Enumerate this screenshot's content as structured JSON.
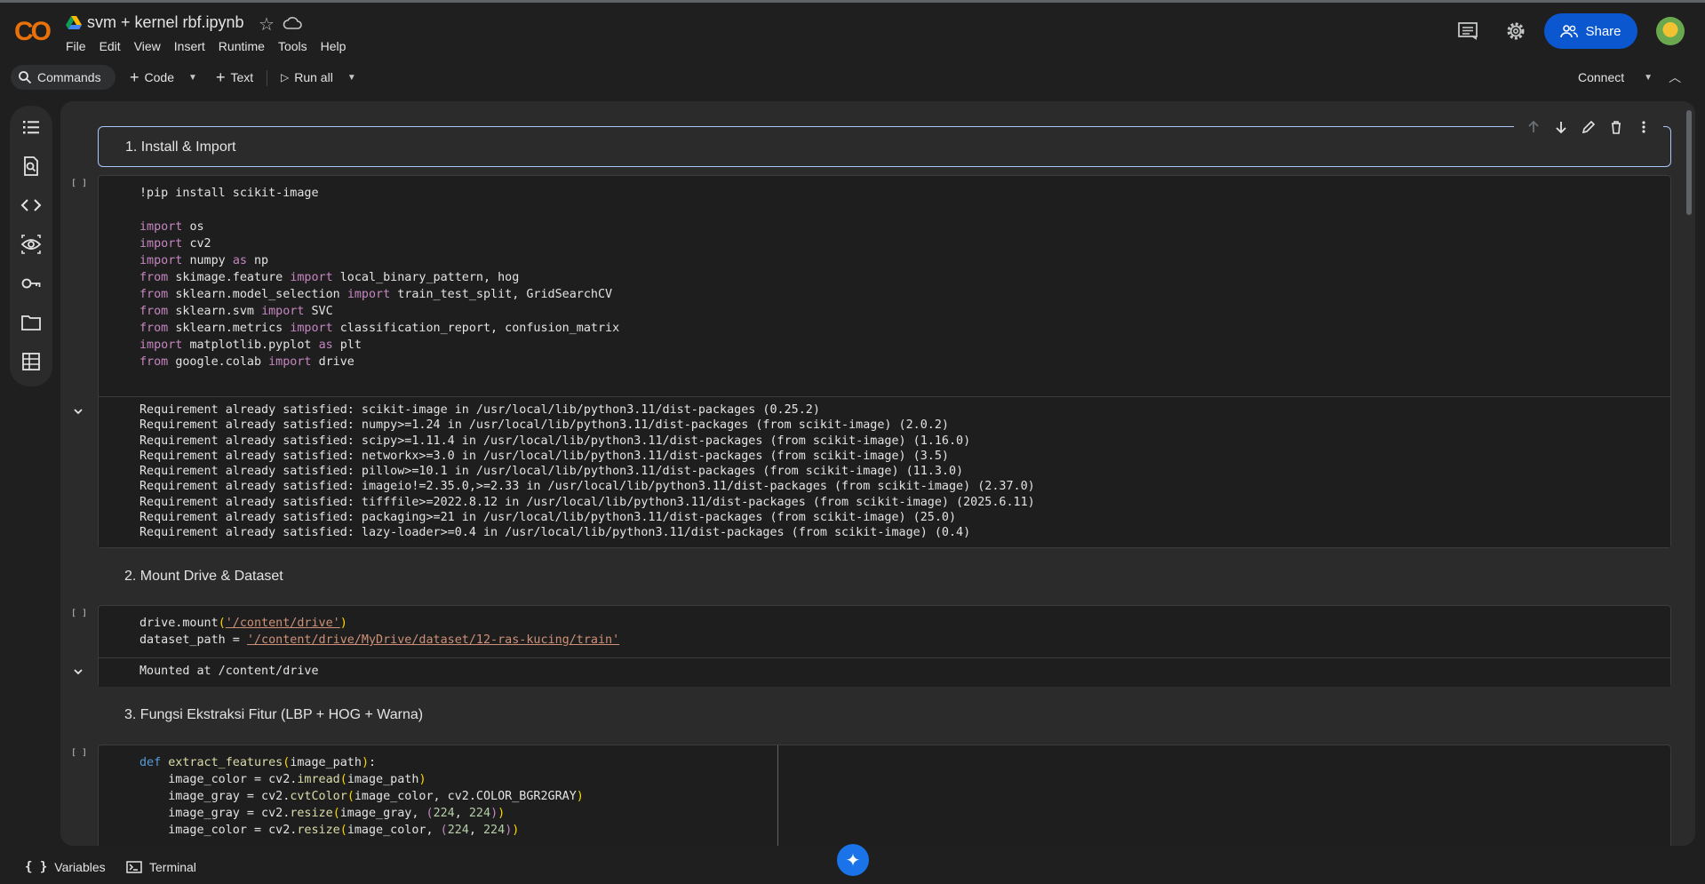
{
  "header": {
    "logo": "CO",
    "title": "svm + kernel rbf.ipynb",
    "menu": [
      "File",
      "Edit",
      "View",
      "Insert",
      "Runtime",
      "Tools",
      "Help"
    ],
    "share_label": "Share"
  },
  "toolbar": {
    "commands": "Commands",
    "code": "Code",
    "text": "Text",
    "run_all": "Run all",
    "connect": "Connect"
  },
  "cells": {
    "md1": "1. Install & Import",
    "md2": "2. Mount Drive & Dataset",
    "md3": "3. Fungsi Ekstraksi Fitur (LBP + HOG + Warna)",
    "exec_bracket": "[ ]",
    "cell1_output": [
      "Requirement already satisfied: scikit-image in /usr/local/lib/python3.11/dist-packages (0.25.2)",
      "Requirement already satisfied: numpy>=1.24 in /usr/local/lib/python3.11/dist-packages (from scikit-image) (2.0.2)",
      "Requirement already satisfied: scipy>=1.11.4 in /usr/local/lib/python3.11/dist-packages (from scikit-image) (1.16.0)",
      "Requirement already satisfied: networkx>=3.0 in /usr/local/lib/python3.11/dist-packages (from scikit-image) (3.5)",
      "Requirement already satisfied: pillow>=10.1 in /usr/local/lib/python3.11/dist-packages (from scikit-image) (11.3.0)",
      "Requirement already satisfied: imageio!=2.35.0,>=2.33 in /usr/local/lib/python3.11/dist-packages (from scikit-image) (2.37.0)",
      "Requirement already satisfied: tifffile>=2022.8.12 in /usr/local/lib/python3.11/dist-packages (from scikit-image) (2025.6.11)",
      "Requirement already satisfied: packaging>=21 in /usr/local/lib/python3.11/dist-packages (from scikit-image) (25.0)",
      "Requirement already satisfied: lazy-loader>=0.4 in /usr/local/lib/python3.11/dist-packages (from scikit-image) (0.4)"
    ],
    "cell2_output": "Mounted at /content/drive",
    "code1": {
      "pip": "!pip install scikit-image",
      "kw_import": "import",
      "kw_from": "from",
      "kw_as": "as",
      "os": "os",
      "cv2": "cv2",
      "numpy": "numpy",
      "np": "np",
      "skimage_feature": "skimage.feature",
      "lbp_hog": "local_binary_pattern, hog",
      "sk_model_sel": "sklearn.model_selection",
      "tts_gs": "train_test_split, GridSearchCV",
      "sk_svm": "sklearn.svm",
      "svc": "SVC",
      "sk_metrics": "sklearn.metrics",
      "cr_cm": "classification_report, confusion_matrix",
      "mpl": "matplotlib.pyplot",
      "plt": "plt",
      "gcolab": "google.colab",
      "drive": "drive"
    },
    "code2": {
      "mount_call": "drive.mount",
      "mount_path": "'/content/drive'",
      "ds_var": "dataset_path = ",
      "ds_path": "'/content/drive/MyDrive/dataset/12-ras-kucing/train'"
    },
    "code3": {
      "def": "def",
      "fname": "extract_features",
      "param": "image_path",
      "l2_a": "    image_color = cv2.",
      "l2_fn": "imread",
      "l2_arg": "image_path",
      "l3_a": "    image_gray = cv2.",
      "l3_fn": "cvtColor",
      "l3_arg": "image_color, cv2.COLOR_BGR2GRAY",
      "l4_a": "    image_gray = cv2.",
      "l4_fn": "resize",
      "l4_arg": "image_gray, ",
      "l5_a": "    image_color = cv2.",
      "l5_fn": "resize",
      "l5_arg": "image_color, ",
      "n224": "224"
    }
  },
  "footer": {
    "variables": "Variables",
    "terminal": "Terminal"
  }
}
